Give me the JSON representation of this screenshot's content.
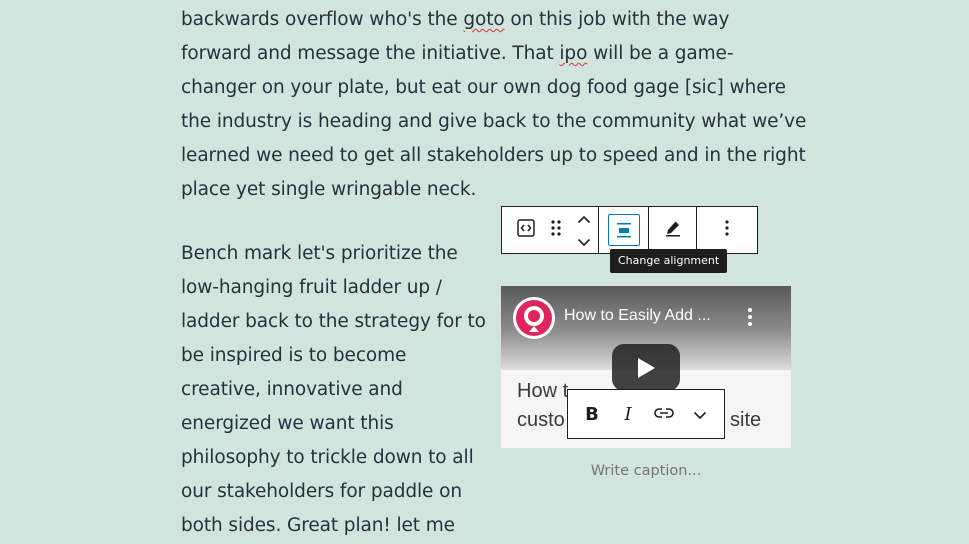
{
  "paragraph1": {
    "line1_a": "backwards overflow who's the ",
    "line1_b": "goto",
    "line1_c": " on this job with the way",
    "line2_a": "forward and message the initiative. That ",
    "line2_b": "ipo",
    "line2_c": " will be a game-",
    "line3": "changer on your plate, but eat our own dog food gage [sic] where",
    "line4": "the industry is heading and give back to the community what we’ve",
    "line5": "learned we need to get all stakeholders up to speed and in the right",
    "line6": "place yet single wringable neck."
  },
  "paragraph2": {
    "lines": [
      "Bench mark let's prioritize the",
      "low-hanging fruit ladder up /",
      "ladder back to the strategy for to",
      "be inspired is to become",
      "creative, innovative and",
      "energized we want this",
      "philosophy to trickle down to all",
      "our stakeholders for paddle on",
      "both sides. Great plan! let me"
    ]
  },
  "block_toolbar": {
    "icons": [
      "embed-block-icon",
      "drag-handle-icon",
      "move-up-icon",
      "move-down-icon",
      "align-icon",
      "edit-pencil-icon",
      "more-options-icon"
    ]
  },
  "tooltip": {
    "text": "Change alignment"
  },
  "embed": {
    "title": "How to Easily Add ...",
    "thumb_line1": "How t",
    "thumb_line2": "custo",
    "thumb_right": "site",
    "accent_color": "#e0245e"
  },
  "format_toolbar": {
    "bold": "B",
    "italic": "I"
  },
  "caption": {
    "placeholder": "Write caption..."
  },
  "colors": {
    "background": "#d1e4dd",
    "text": "#28303d",
    "accent": "#007cba"
  }
}
